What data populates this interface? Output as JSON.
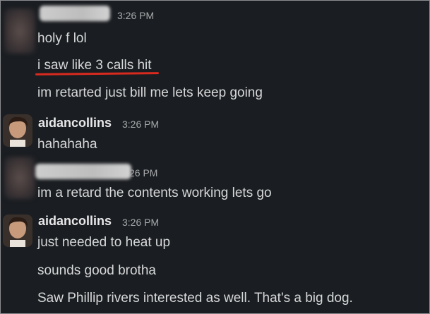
{
  "messages": {
    "first_group": {
      "time": "3:26 PM",
      "lines": [
        "holy f lol",
        "i saw like 3 calls hit",
        "im retarted just bill me lets keep going"
      ]
    },
    "aidan_group_1": {
      "username": "aidancollins",
      "time": "3:26 PM",
      "lines": [
        "hahahaha"
      ]
    },
    "second_group": {
      "time_partial": "26 PM",
      "lines": [
        "im a retard the contents working lets go"
      ]
    },
    "aidan_group_2": {
      "username": "aidancollins",
      "time": "3:26 PM",
      "lines": [
        "just needed to heat up",
        "sounds good brotha",
        "Saw Phillip rivers interested as well. That's a big dog."
      ]
    }
  },
  "colors": {
    "background": "#1a1d21",
    "annotation_underline": "#d92a1f"
  }
}
